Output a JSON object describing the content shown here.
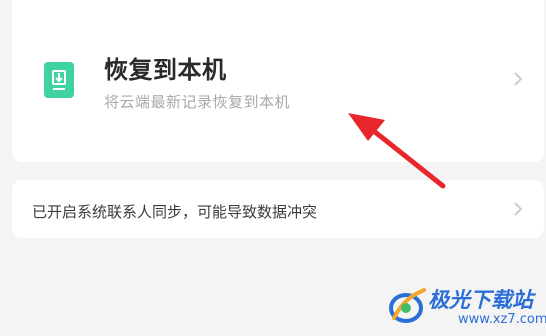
{
  "restore": {
    "title": "恢复到本机",
    "subtitle": "将云端最新记录恢复到本机",
    "icon": "download-to-phone-icon",
    "icon_color": "#3fd3a4"
  },
  "sync": {
    "label": "已开启系统联系人同步，可能导致数据冲突"
  },
  "annotation": {
    "arrow_color": "#e8262b"
  },
  "watermark": {
    "brand": "极光下载站",
    "url": "www.xz7.com"
  },
  "colors": {
    "background": "#f4f4f5",
    "card": "#ffffff",
    "title": "#2a2a2a",
    "subtitle": "#a9a9ad",
    "accent_green": "#3fd3a4",
    "watermark_blue": "#2b6fd6"
  }
}
